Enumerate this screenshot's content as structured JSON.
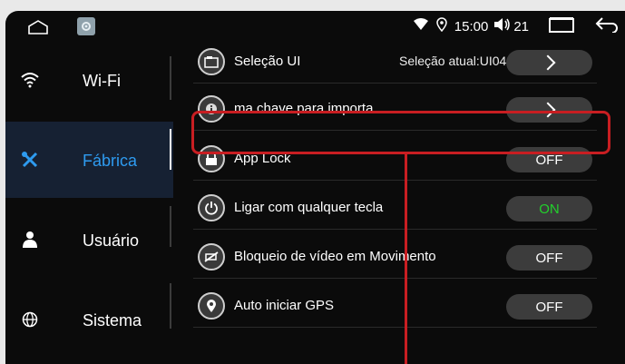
{
  "status_bar": {
    "time": "15:00",
    "volume": "21"
  },
  "sidebar": {
    "items": [
      {
        "label": "Wi-Fi",
        "icon": "wifi-icon"
      },
      {
        "label": "Fábrica",
        "icon": "tools-icon",
        "active": true
      },
      {
        "label": "Usuário",
        "icon": "user-icon"
      },
      {
        "label": "Sistema",
        "icon": "globe-icon"
      }
    ]
  },
  "settings": {
    "rows": [
      {
        "label": "Seleção UI",
        "value": "Seleção atual:UI04",
        "control": "arrow",
        "icon": "ui-selection-icon"
      },
      {
        "label": "ma chave para importa",
        "value": "",
        "control": "arrow",
        "icon": "info-key-icon"
      },
      {
        "label": "App Lock",
        "value": "",
        "control": "OFF",
        "icon": "lock-icon"
      },
      {
        "label": "Ligar com qualquer tecla",
        "value": "",
        "control": "ON",
        "icon": "power-icon"
      },
      {
        "label": "Bloqueio de vídeo em Movimento",
        "value": "",
        "control": "OFF",
        "icon": "video-block-icon"
      },
      {
        "label": "Auto iniciar GPS",
        "value": "",
        "control": "OFF",
        "icon": "gps-pin-icon"
      }
    ]
  },
  "colors": {
    "accent": "#2e9bf0",
    "on": "#22d12c",
    "highlight": "#c81e22"
  }
}
